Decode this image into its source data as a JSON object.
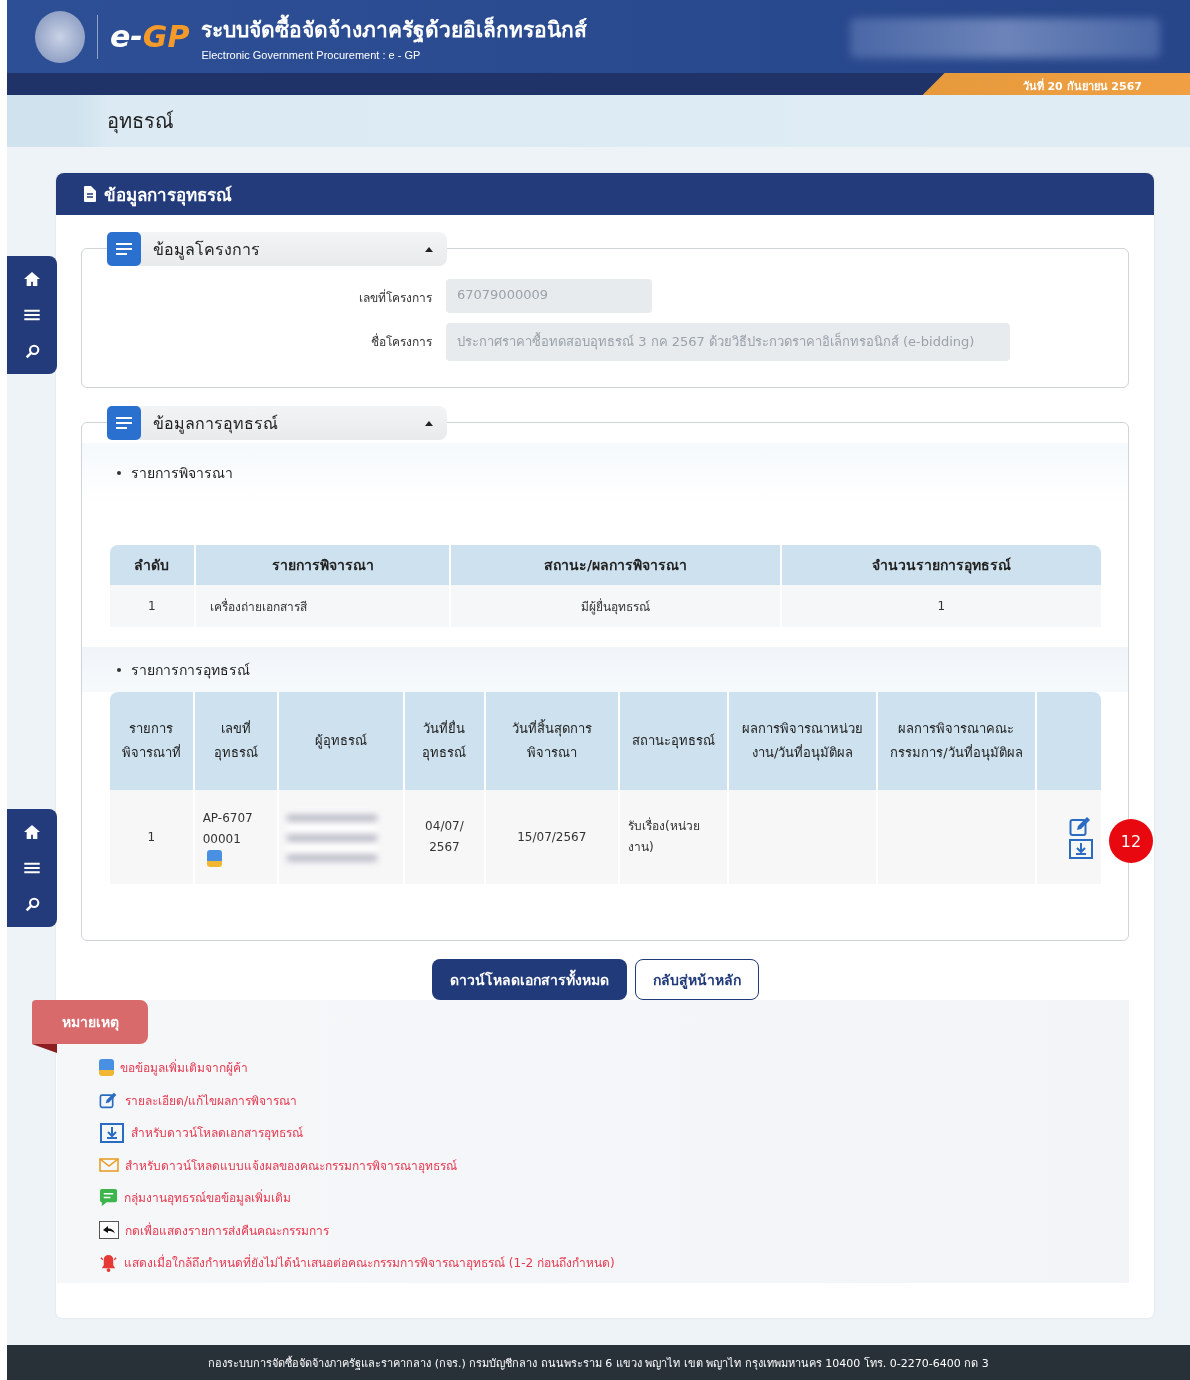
{
  "header": {
    "title": "ระบบจัดซื้อจัดจ้างภาครัฐด้วยอิเล็กทรอนิกส์",
    "subtitle": "Electronic Government Procurement : e - GP",
    "logo_text_1": "e-",
    "logo_text_2": "GP",
    "date": "วันที่ 20 กันยายน 2567"
  },
  "page_title": "อุทธรณ์",
  "card_title": "ข้อมูลการอุทธรณ์",
  "project_section": {
    "title": "ข้อมูลโครงการ",
    "expanded": true,
    "fields": [
      {
        "label": "เลขที่โครงการ",
        "value": "67079000009",
        "kind": "input"
      },
      {
        "label": "ชื่อโครงการ",
        "value": "ประกาศราคาซื้อทดสอบอุทธรณ์ 3 กค 2567 ด้วยวิธีประกวดราคาอิเล็กทรอนิกส์ (e-bidding)",
        "kind": "textarea"
      }
    ]
  },
  "appeal_section": {
    "title": "ข้อมูลการอุทธรณ์",
    "expanded": true,
    "list_1_title": "รายการพิจารณา",
    "table_1": {
      "columns": [
        "ลำดับ",
        "รายการพิจารณา",
        "สถานะ/ผลการพิจารณา",
        "จำนวนรายการอุทธรณ์"
      ],
      "rows": [
        [
          "1",
          "เครื่องถ่ายเอกสารสี",
          "มีผู้ยื่นอุทธรณ์",
          "1"
        ]
      ]
    },
    "list_2_title": "รายการการอุทธรณ์",
    "table_2": {
      "columns": [
        "รายการพิจารณาที่",
        "เลขที่อุทธรณ์",
        "ผู้อุทธรณ์",
        "วันที่ยื่นอุทธรณ์",
        "วันที่สิ้นสุดการพิจารณา",
        "สถานะอุทธรณ์",
        "ผลการพิจารณาหน่วยงาน/วันที่อนุมัติผล",
        "ผลการพิจารณาคณะกรรมการ/วันที่อนุมัติผล"
      ],
      "rows": [
        {
          "item": "1",
          "appeal_no": "AP-670700001",
          "submitted": "04/07/2567",
          "deadline": "15/07/2567",
          "status": "รับเรื่อง(หน่วยงาน)",
          "badge": "12"
        }
      ]
    }
  },
  "buttons": [
    {
      "label": "ดาวน์โหลดเอกสารทั้งหมด",
      "kind": "primary"
    },
    {
      "label": "กลับสู่หน้าหลัก",
      "kind": "outline"
    }
  ],
  "legend": {
    "title": "หมายเหตุ",
    "items": [
      {
        "kind": "request",
        "text": "ขอข้อมูลเพิ่มเติมจากผู้ค้า"
      },
      {
        "kind": "edit",
        "text": "รายละเอียด/แก้ไขผลการพิจารณา"
      },
      {
        "kind": "download",
        "text": "สำหรับดาวน์โหลดเอกสารอุทธรณ์"
      },
      {
        "kind": "mail",
        "text": "สำหรับดาวน์โหลดแบบแจ้งผลของคณะกรรมการพิจารณาอุทธรณ์"
      },
      {
        "kind": "chat",
        "text": "กลุ่มงานอุทธรณ์ขอข้อมูลเพิ่มเติม"
      },
      {
        "kind": "return",
        "text": "กดเพื่อแสดงรายการส่งคืนคณะกรรมการ"
      },
      {
        "kind": "alarm",
        "text": "แสดงเมื่อใกล้ถึงกำหนดที่ยังไม่ได้นำเสนอต่อคณะกรรมการพิจารณาอุทธรณ์ (1-2 ก่อนถึงกำหนด)"
      }
    ]
  },
  "footer": "กองระบบการจัดซื้อจัดจ้างภาครัฐและราคากลาง (กจร.) กรมบัญชีกลาง ถนนพระราม 6 แขวง พญาไท เขต พญาไท กรุงเทพมหานคร 10400 โทร. 0-2270-6400 กด 3"
}
